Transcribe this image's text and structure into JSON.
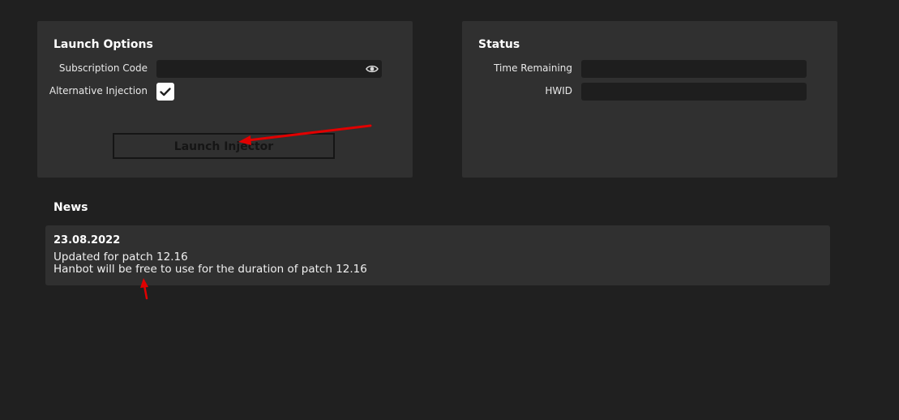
{
  "launch_options": {
    "title": "Launch Options",
    "subscription_label": "Subscription Code",
    "subscription_value": "",
    "alt_injection_label": "Alternative Injection",
    "alt_injection_checked": true,
    "launch_button_label": "Launch Injector",
    "reveal_icon": "eye-icon",
    "check_icon": "checkmark-icon"
  },
  "status": {
    "title": "Status",
    "time_label": "Time Remaining",
    "time_value": "",
    "hwid_label": "HWID",
    "hwid_value": ""
  },
  "news": {
    "title": "News",
    "items": [
      {
        "date": "23.08.2022",
        "lines": [
          "Updated for patch 12.16",
          "Hanbot will be free to use for the duration of patch 12.16"
        ]
      }
    ]
  },
  "colors": {
    "background": "#202020",
    "panel": "#303030",
    "field": "#1e1e1e",
    "annotation_arrow": "#e00000"
  }
}
